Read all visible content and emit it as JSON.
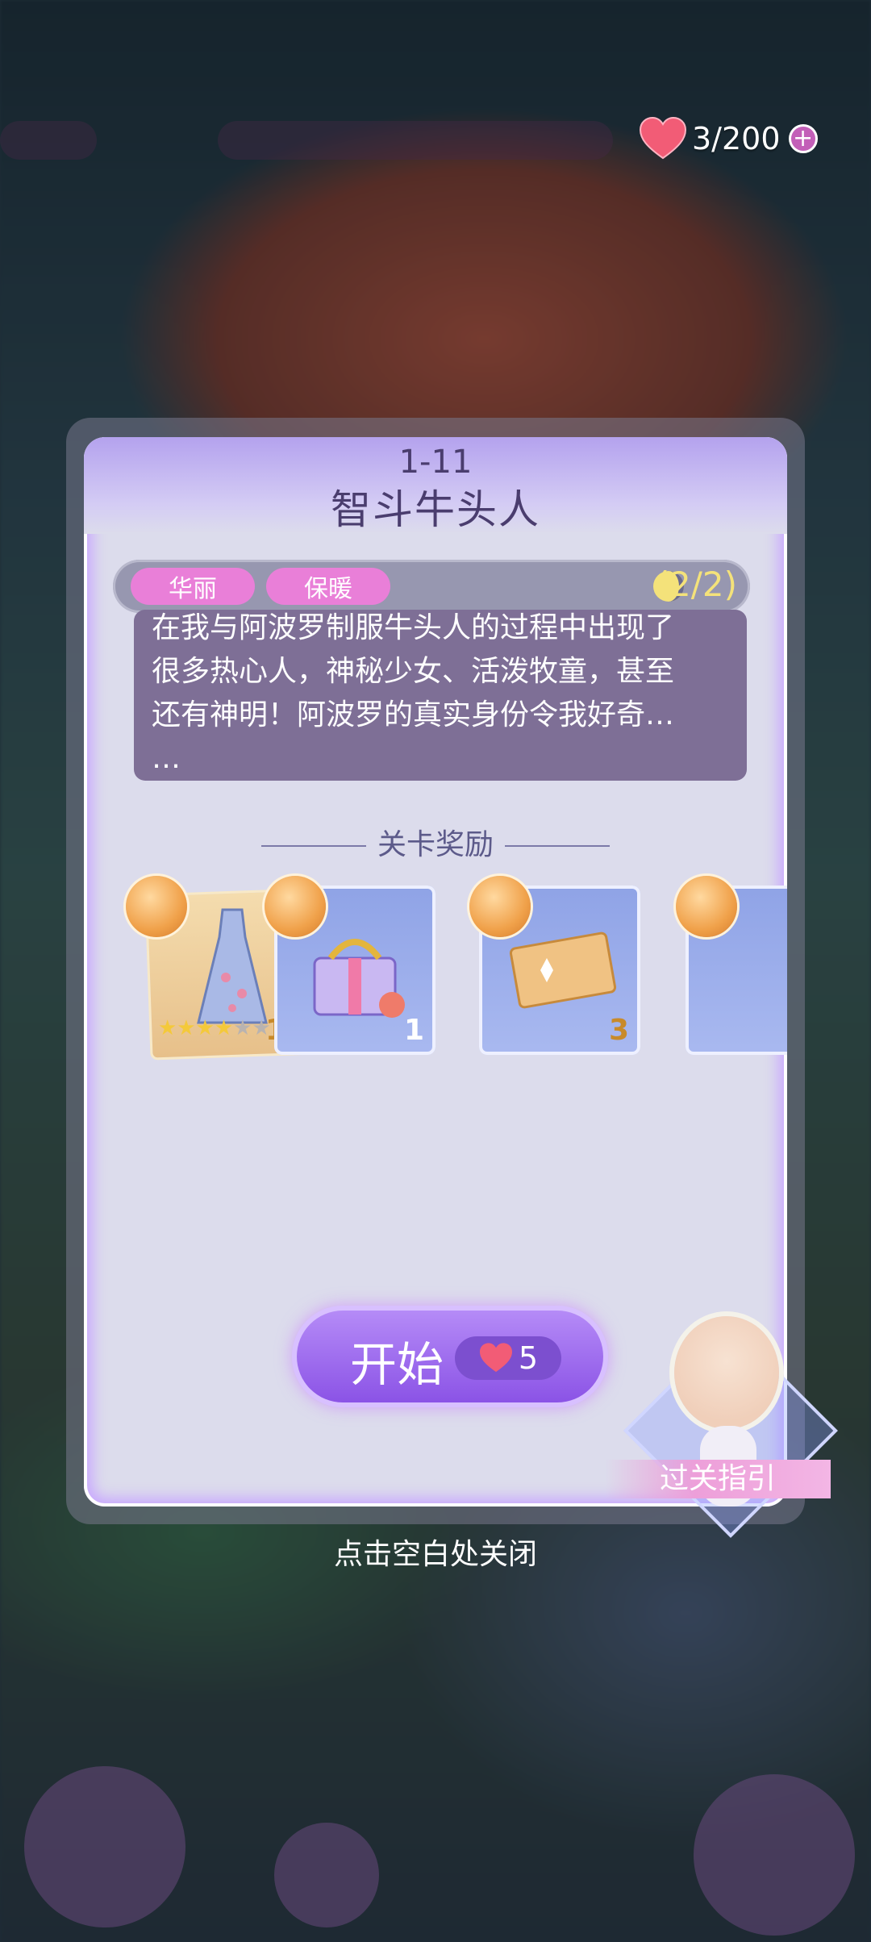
{
  "status_bar": {
    "hearts": "3/200",
    "plus_icon": "plus-circle-icon",
    "heart_color": "#f25c76"
  },
  "panel": {
    "level_number": "1-11",
    "level_name": "智斗牛头人",
    "tags": [
      "华丽",
      "保暖"
    ],
    "moon_icon": "half-moon-icon",
    "progress": "(2/2)",
    "story_lines": [
      "在我与阿波罗制服牛头人的过程中出现了",
      "很多热心人，神秘少女、活泼牧童，甚至",
      "还有神明！阿波罗的真实身份令我好奇…",
      "…"
    ],
    "reward_title": "关卡奖励",
    "rewards": [
      {
        "name": "dress-card",
        "count": "1",
        "stars": "★★★★★★"
      },
      {
        "name": "gift-box",
        "count": "1"
      },
      {
        "name": "ticket",
        "count": "3"
      }
    ],
    "start_label": "开始",
    "start_cost": "5",
    "accent_purple": "#8b53e6",
    "tag_pink": "#e97fd8"
  },
  "guide": {
    "label": "过关指引"
  },
  "close_hint": "点击空白处关闭"
}
